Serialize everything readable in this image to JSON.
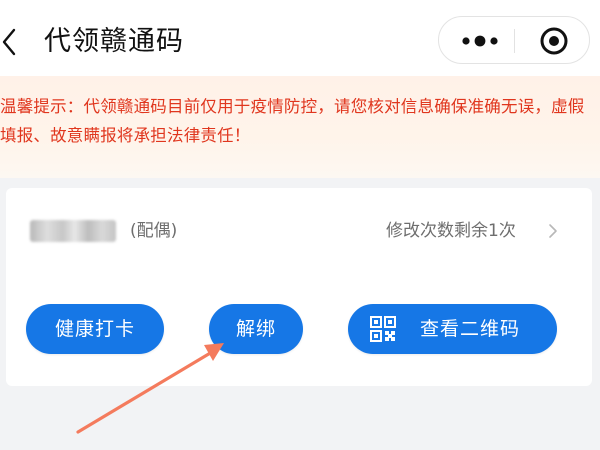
{
  "header": {
    "title": "代领赣通码",
    "back_icon": "chevron-left-icon",
    "more_icon": "more-dots-icon",
    "close_icon": "target-circle-icon"
  },
  "notice": {
    "text": "温馨提示：代领赣通码目前仅用于疫情防控，请您核对信息确保准确无误，虚假填报、故意瞒报将承担法律责任！",
    "color": "#e0361e"
  },
  "person": {
    "relation": "(配偶)",
    "edit_info": "修改次数剩余1次"
  },
  "buttons": {
    "health_checkin": "健康打卡",
    "unbind": "解绑",
    "view_qr": "查看二维码"
  },
  "colors": {
    "primary": "#1677e6",
    "annotation_arrow": "#f47b5d"
  }
}
